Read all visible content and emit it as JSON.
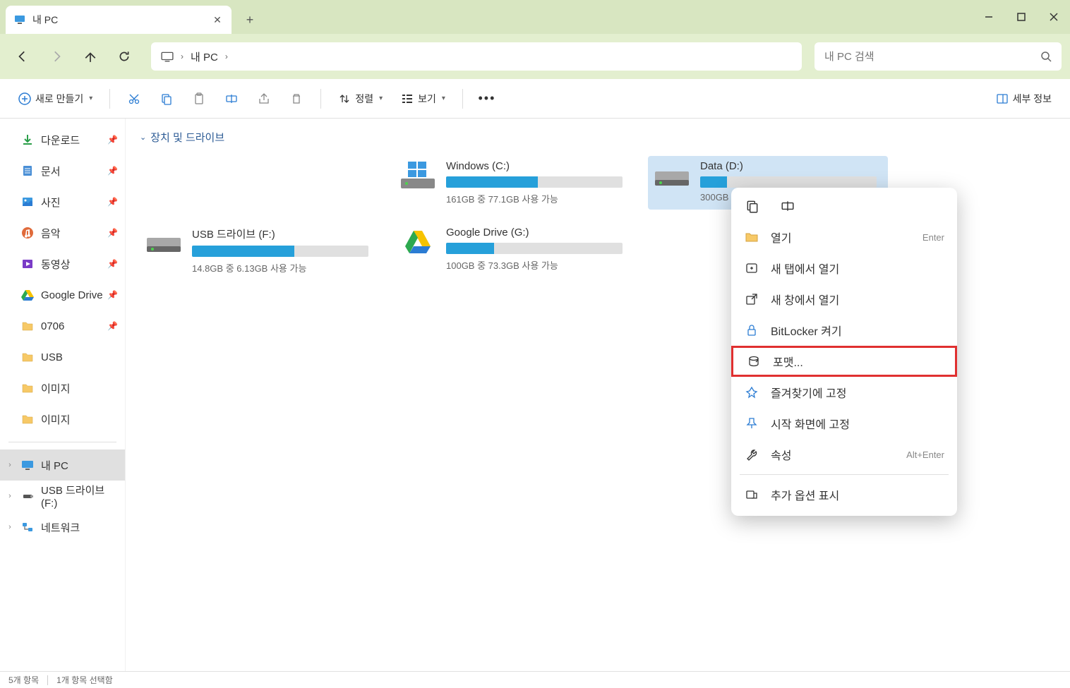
{
  "tab": {
    "title": "내 PC"
  },
  "window": {
    "minimize": "—",
    "maximize": "☐",
    "close": "✕"
  },
  "address": {
    "location": "내 PC"
  },
  "search": {
    "placeholder": "내 PC 검색"
  },
  "toolbar": {
    "new": "새로 만들기",
    "sort": "정렬",
    "view": "보기",
    "details": "세부 정보"
  },
  "sidebar": {
    "items": [
      {
        "label": "다운로드",
        "pinned": true,
        "icon": "download"
      },
      {
        "label": "문서",
        "pinned": true,
        "icon": "document"
      },
      {
        "label": "사진",
        "pinned": true,
        "icon": "picture"
      },
      {
        "label": "음악",
        "pinned": true,
        "icon": "music"
      },
      {
        "label": "동영상",
        "pinned": true,
        "icon": "video"
      },
      {
        "label": "Google Drive",
        "pinned": true,
        "icon": "gdrive"
      },
      {
        "label": "0706",
        "pinned": true,
        "icon": "folder"
      },
      {
        "label": "USB",
        "pinned": false,
        "icon": "folder"
      },
      {
        "label": "이미지",
        "pinned": false,
        "icon": "folder"
      },
      {
        "label": "이미지",
        "pinned": false,
        "icon": "folder"
      }
    ],
    "thispc": "내 PC",
    "usb": "USB 드라이브 (F:)",
    "network": "네트워크"
  },
  "content": {
    "group": "장치 및 드라이브",
    "drives": [
      {
        "name": "",
        "text": "",
        "fill": 0,
        "icon": "blank"
      },
      {
        "name": "Windows (C:)",
        "text": "161GB 중 77.1GB 사용 가능",
        "fill": 52,
        "icon": "windrive"
      },
      {
        "name": "Data (D:)",
        "text": "300GB",
        "fill": 15,
        "icon": "drive",
        "selected": true
      },
      {
        "name": "USB 드라이브 (F:)",
        "text": "14.8GB 중 6.13GB 사용 가능",
        "fill": 58,
        "icon": "drive"
      },
      {
        "name": "Google Drive (G:)",
        "text": "100GB 중 73.3GB 사용 가능",
        "fill": 27,
        "icon": "gdrive"
      }
    ]
  },
  "contextmenu": {
    "open": "열기",
    "open_shortcut": "Enter",
    "newtab": "새 탭에서 열기",
    "newwindow": "새 창에서 열기",
    "bitlocker": "BitLocker 켜기",
    "format": "포맷...",
    "pinfav": "즐겨찾기에 고정",
    "pinstart": "시작 화면에 고정",
    "properties": "속성",
    "properties_shortcut": "Alt+Enter",
    "more": "추가 옵션 표시"
  },
  "status": {
    "count": "5개 항목",
    "selected": "1개 항목 선택함"
  }
}
